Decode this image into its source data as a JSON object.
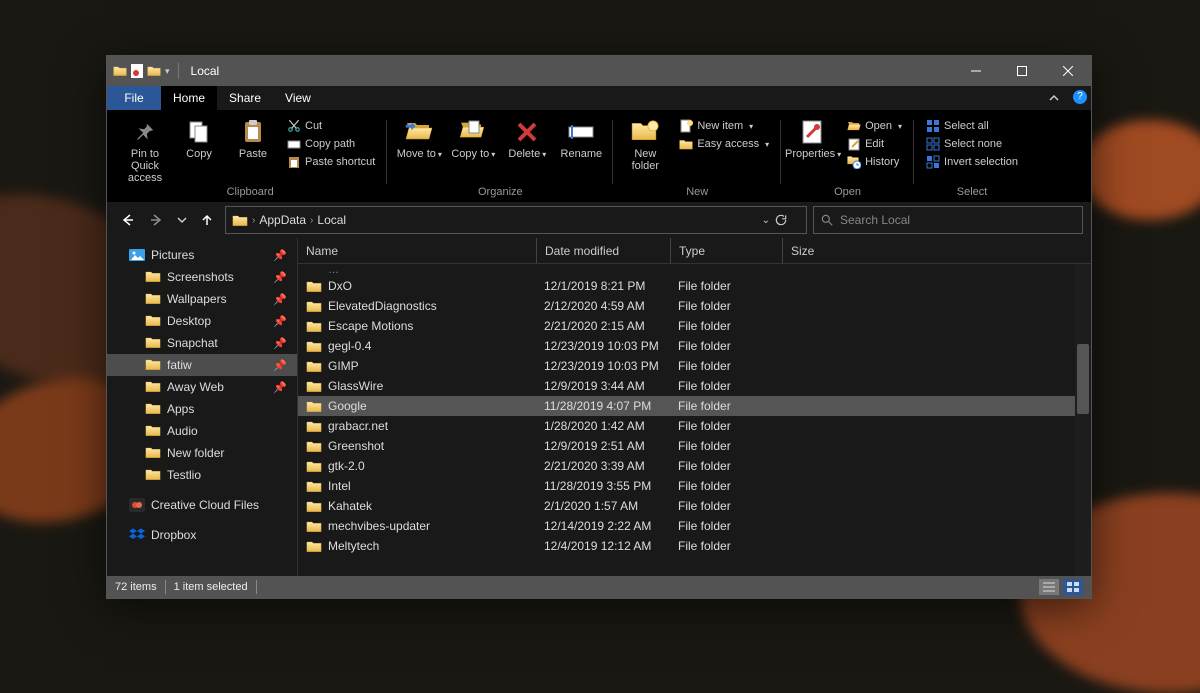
{
  "window": {
    "title": "Local"
  },
  "menu": {
    "file": "File",
    "tabs": [
      "Home",
      "Share",
      "View"
    ],
    "active": 0
  },
  "ribbon": {
    "groups": {
      "clipboard": {
        "label": "Clipboard",
        "pin": "Pin to Quick access",
        "copy": "Copy",
        "paste": "Paste",
        "cut": "Cut",
        "copypath": "Copy path",
        "pasteshortcut": "Paste shortcut"
      },
      "organize": {
        "label": "Organize",
        "moveto": "Move to",
        "copyto": "Copy to",
        "delete": "Delete",
        "rename": "Rename"
      },
      "new": {
        "label": "New",
        "newfolder": "New folder",
        "newitem": "New item",
        "easyaccess": "Easy access"
      },
      "open": {
        "label": "Open",
        "properties": "Properties",
        "open": "Open",
        "edit": "Edit",
        "history": "History"
      },
      "select": {
        "label": "Select",
        "selectall": "Select all",
        "selectnone": "Select none",
        "invert": "Invert selection"
      }
    }
  },
  "address": {
    "crumbs": [
      "AppData",
      "Local"
    ]
  },
  "search": {
    "placeholder": "Search Local"
  },
  "sidebar": {
    "items": [
      {
        "label": "Pictures",
        "icon": "pictures",
        "pinned": true,
        "indent": 1
      },
      {
        "label": "Screenshots",
        "icon": "folder",
        "pinned": true,
        "indent": 2
      },
      {
        "label": "Wallpapers",
        "icon": "folder",
        "pinned": true,
        "indent": 2
      },
      {
        "label": "Desktop",
        "icon": "folder",
        "pinned": true,
        "indent": 2
      },
      {
        "label": "Snapchat",
        "icon": "folder",
        "pinned": true,
        "indent": 2
      },
      {
        "label": "fatiw",
        "icon": "folder",
        "pinned": true,
        "indent": 2,
        "selected": true
      },
      {
        "label": "Away Web",
        "icon": "folder",
        "pinned": true,
        "indent": 2
      },
      {
        "label": "Apps",
        "icon": "folder",
        "pinned": false,
        "indent": 2
      },
      {
        "label": "Audio",
        "icon": "folder",
        "pinned": false,
        "indent": 2
      },
      {
        "label": "New folder",
        "icon": "folder",
        "pinned": false,
        "indent": 2
      },
      {
        "label": "Testlio",
        "icon": "folder",
        "pinned": false,
        "indent": 2
      },
      {
        "label": "Creative Cloud Files",
        "icon": "cc",
        "pinned": false,
        "indent": 1
      },
      {
        "label": "Dropbox",
        "icon": "dropbox",
        "pinned": false,
        "indent": 1
      }
    ]
  },
  "columns": {
    "name": "Name",
    "date": "Date modified",
    "type": "Type",
    "size": "Size"
  },
  "files": [
    {
      "name": "DxO",
      "date": "12/1/2019 8:21 PM",
      "type": "File folder"
    },
    {
      "name": "ElevatedDiagnostics",
      "date": "2/12/2020 4:59 AM",
      "type": "File folder"
    },
    {
      "name": "Escape Motions",
      "date": "2/21/2020 2:15 AM",
      "type": "File folder"
    },
    {
      "name": "gegl-0.4",
      "date": "12/23/2019 10:03 PM",
      "type": "File folder"
    },
    {
      "name": "GIMP",
      "date": "12/23/2019 10:03 PM",
      "type": "File folder"
    },
    {
      "name": "GlassWire",
      "date": "12/9/2019 3:44 AM",
      "type": "File folder"
    },
    {
      "name": "Google",
      "date": "11/28/2019 4:07 PM",
      "type": "File folder",
      "selected": true
    },
    {
      "name": "grabacr.net",
      "date": "1/28/2020 1:42 AM",
      "type": "File folder"
    },
    {
      "name": "Greenshot",
      "date": "12/9/2019 2:51 AM",
      "type": "File folder"
    },
    {
      "name": "gtk-2.0",
      "date": "2/21/2020 3:39 AM",
      "type": "File folder"
    },
    {
      "name": "Intel",
      "date": "11/28/2019 3:55 PM",
      "type": "File folder"
    },
    {
      "name": "Kahatek",
      "date": "2/1/2020 1:57 AM",
      "type": "File folder"
    },
    {
      "name": "mechvibes-updater",
      "date": "12/14/2019 2:22 AM",
      "type": "File folder"
    },
    {
      "name": "Meltytech",
      "date": "12/4/2019 12:12 AM",
      "type": "File folder"
    }
  ],
  "status": {
    "items": "72 items",
    "selected": "1 item selected"
  }
}
